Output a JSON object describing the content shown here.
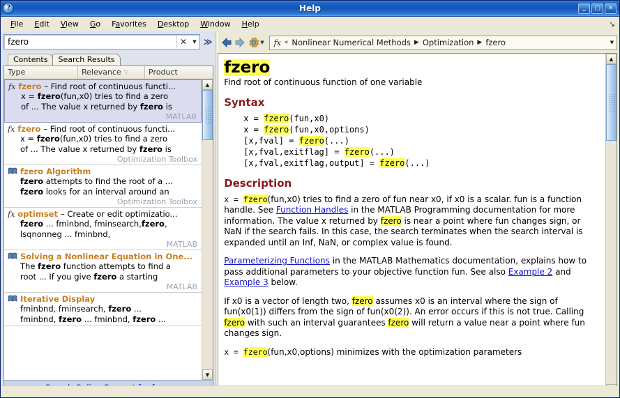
{
  "window": {
    "title": "Help",
    "icon": "help-circle-icon",
    "buttons": {
      "minimize": "_",
      "maximize": "□",
      "close": "✕"
    }
  },
  "menubar": {
    "items": [
      "File",
      "Edit",
      "View",
      "Go",
      "Favorites",
      "Desktop",
      "Window",
      "Help"
    ],
    "overflow_glyph": "↘"
  },
  "search": {
    "value": "fzero",
    "placeholder": "",
    "clear_glyph": "✕",
    "dropdown_glyph": "▼",
    "collapse_glyph": "≫"
  },
  "tabs": [
    {
      "label": "Contents",
      "active": false
    },
    {
      "label": "Search Results",
      "active": true
    }
  ],
  "columns": [
    {
      "label": "Type",
      "sorted": false
    },
    {
      "label": "Relevance",
      "sorted": true,
      "sort_glyph": "▽"
    },
    {
      "label": "Product",
      "sorted": false
    }
  ],
  "results": [
    {
      "icon": "fx-icon",
      "term": "fzero",
      "dash": "–",
      "title_rest": "Find root of continuous functi...",
      "lines": [
        "x = fzero(fun,x0) tries to find a zero",
        "of ... The value x returned by fzero is"
      ],
      "product": "MATLAB",
      "selected": true
    },
    {
      "icon": "fx-icon",
      "term": "fzero",
      "dash": "–",
      "title_rest": "Find root of continuous functi...",
      "lines": [
        "x = fzero(fun,x0) tries to find a zero",
        "of ... The value x returned by fzero is"
      ],
      "product": "Optimization Toolbox",
      "selected": false
    },
    {
      "icon": "book-icon",
      "term": "fzero Algorithm",
      "dash": "",
      "title_rest": "",
      "lines": [
        "fzero attempts to find the root of a ...",
        "fzero looks for an interval around an"
      ],
      "product": "Optimization Toolbox",
      "selected": false
    },
    {
      "icon": "fx-icon",
      "term": "optimset",
      "dash": "–",
      "title_rest": "Create or edit optimizatio...",
      "lines": [
        "fzero ... fminbnd, fminsearch,fzero,",
        "lsqnonneg ... fminbnd,"
      ],
      "product": "MATLAB",
      "selected": false
    },
    {
      "icon": "book-icon",
      "term": "Solving a Nonlinear Equation in One...",
      "dash": "",
      "title_rest": "",
      "lines": [
        "The fzero function attempts to find a",
        "root ... If you give fzero a starting"
      ],
      "product": "MATLAB",
      "selected": false
    },
    {
      "icon": "book-icon",
      "term": "Iterative Display",
      "dash": "",
      "title_rest": "",
      "lines": [
        "fminbnd, fminsearch, fzero ...",
        "fminbnd, fzero ... fminbnd, fzero ..."
      ],
      "product": "",
      "selected": false
    }
  ],
  "online_support": {
    "label": "Search Online Support for fzero"
  },
  "doc_toolbar": {
    "back": "back-arrow-icon",
    "forward": "forward-arrow-icon",
    "gear": "gear-icon",
    "gear_caret": "▾",
    "breadcrumb": {
      "fx": "fx",
      "prefix": "«",
      "crumbs": [
        "Nonlinear Numerical Methods",
        "Optimization",
        "fzero"
      ],
      "separator": "▶",
      "caret": "▼"
    }
  },
  "doc": {
    "title": "fzero",
    "subtitle": "Find root of continuous function of one variable",
    "syntax_heading": "Syntax",
    "syntax_lines": [
      "x = fzero(fun,x0)",
      "x = fzero(fun,x0,options)",
      "[x,fval] = fzero(...)",
      "[x,fval,exitflag] = fzero(...)",
      "[x,fval,exitflag,output] = fzero(...)"
    ],
    "description_heading": "Description",
    "paragraph1": {
      "p1a": "x = ",
      "p1hl": "fzero",
      "p1b": "(fun,x0) tries to find a zero of fun near x0, if x0 is a scalar. fun is a function handle. See ",
      "link1": "Function Handles",
      "p1c": " in the MATLAB Programming documentation for more information. The value x returned by ",
      "p1hl2": "fzero",
      "p1d": " is near a point where fun changes sign, or NaN if the search fails. In this case, the search terminates when the search interval is expanded until an Inf, NaN, or complex value is found."
    },
    "paragraph2": {
      "link1": "Parameterizing Functions",
      "p2a": " in the MATLAB Mathematics documentation, explains how to pass additional parameters to your objective function fun. See also ",
      "link2": "Example 2",
      "p2b": " and ",
      "link3": "Example 3",
      "p2c": " below."
    },
    "paragraph3": {
      "p3a": "If x0 is a vector of length two, ",
      "hl1": "fzero",
      "p3b": " assumes x0 is an interval where the sign of fun(x0(1)) differs from the sign of fun(x0(2)). An error occurs if this is not true. Calling ",
      "hl2": "fzero",
      "p3c": " with such an interval guarantees ",
      "hl3": "fzero",
      "p3d": " will return a value near a point where fun changes sign."
    },
    "paragraph4": {
      "p4a": "x = ",
      "hl1": "fzero",
      "p4b": "(fun,x0,options) minimizes with the optimization parameters"
    }
  },
  "colors": {
    "titlebar": "#1d62c4",
    "highlight": "#ffff55",
    "heading": "#8b1a1a",
    "link": "#1414c8",
    "term": "#c87f20",
    "selection": "#dcdcf0",
    "chrome": "#ece9d8"
  }
}
